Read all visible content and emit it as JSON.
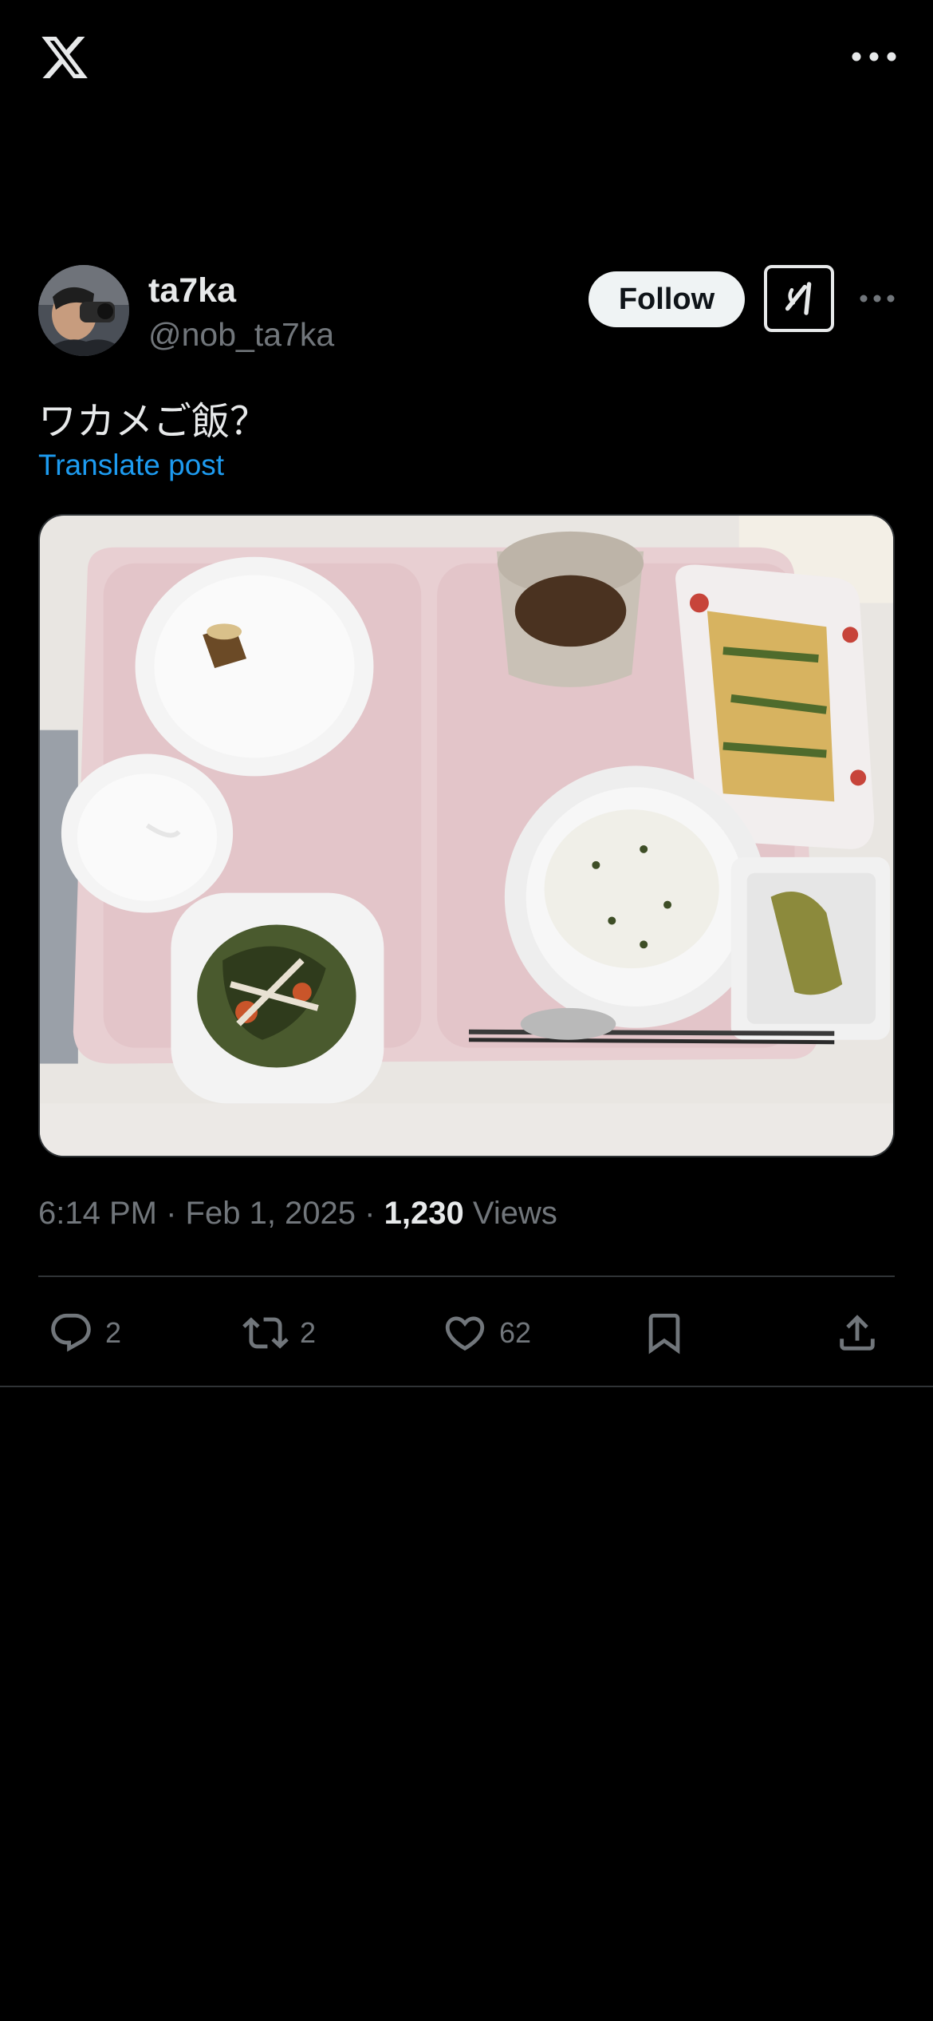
{
  "app": {
    "logo_icon": "x-logo-icon",
    "more_icon": "more-horizontal-icon"
  },
  "post": {
    "author": {
      "display_name": "ta7ka",
      "handle": "@nob_ta7ka",
      "avatar_icon": "avatar-photo"
    },
    "follow_label": "Follow",
    "grok_icon": "grok-icon",
    "text": "ワカメご飯？",
    "translate_label": "Translate post",
    "media": {
      "kind": "photo",
      "icon": "meal-tray-photo"
    },
    "time": "6:14 PM",
    "separator": "·",
    "date": "Feb 1, 2025",
    "views_count": "1,230",
    "views_label": "Views"
  },
  "actions": {
    "reply": {
      "icon": "reply-icon",
      "count": "2"
    },
    "repost": {
      "icon": "repost-icon",
      "count": "2"
    },
    "like": {
      "icon": "heart-icon",
      "count": "62"
    },
    "bookmark": {
      "icon": "bookmark-icon"
    },
    "share": {
      "icon": "share-icon"
    }
  },
  "colors": {
    "background": "#000000",
    "text_primary": "#e7e9ea",
    "text_secondary": "#71767b",
    "link": "#1d9bf0",
    "divider": "#2f3336",
    "follow_bg": "#eff3f4"
  }
}
